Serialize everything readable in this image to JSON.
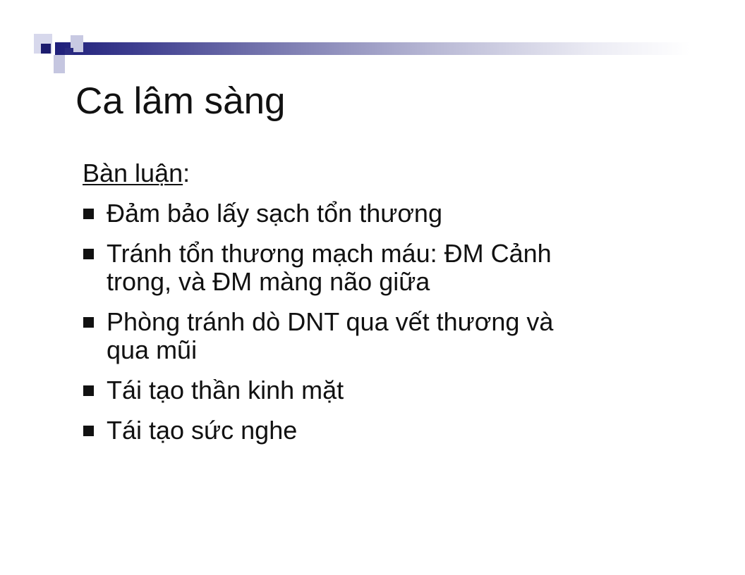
{
  "colors": {
    "bar_dark": "#1f1f7a",
    "bar_light": "#ffffff",
    "square_dark": "#1c1c6e",
    "square_light": "#d7d8ec",
    "text": "#111111"
  },
  "slide": {
    "title": "Ca lâm sàng",
    "section_heading": "Bàn luận",
    "section_colon": ":",
    "bullet_icon": "square-bullet-icon",
    "bullets": [
      {
        "lines": [
          "Đảm bảo lấy sạch tổn thương"
        ]
      },
      {
        "lines": [
          "Tránh tổn thương mạch máu: ĐM Cảnh",
          "trong, và ĐM màng não giữa"
        ]
      },
      {
        "lines": [
          "Phòng tránh dò DNT qua vết thương và",
          "qua mũi"
        ]
      },
      {
        "lines": [
          "Tái tạo thần kinh mặt"
        ]
      },
      {
        "lines": [
          "Tái tạo sức nghe"
        ]
      }
    ]
  }
}
